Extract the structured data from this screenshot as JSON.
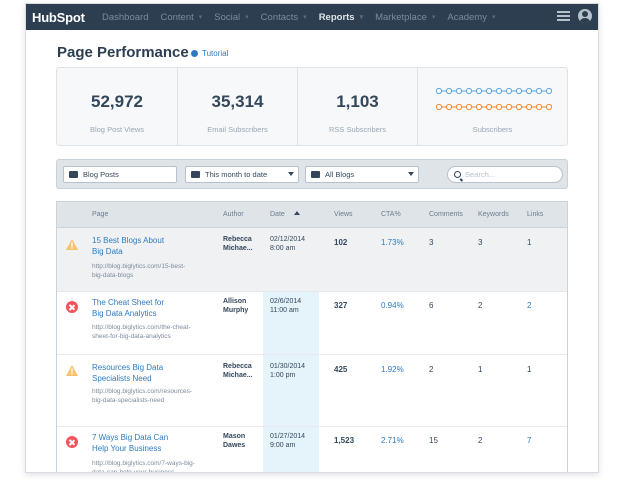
{
  "nav": {
    "logo": "HubSpot",
    "items": [
      {
        "label": "Dashboard",
        "caret": false
      },
      {
        "label": "Content",
        "caret": true
      },
      {
        "label": "Social",
        "caret": true
      },
      {
        "label": "Contacts",
        "caret": true
      },
      {
        "label": "Reports",
        "caret": true,
        "active": true
      },
      {
        "label": "Marketplace",
        "caret": true
      },
      {
        "label": "Academy",
        "caret": true
      }
    ],
    "caret_glyph": "▾"
  },
  "page": {
    "title": "Page Performance",
    "tutorial_label": "Tutorial"
  },
  "stats": [
    {
      "value": "52,972",
      "label": "Blog Post Views"
    },
    {
      "value": "35,314",
      "label": "Email Subscribers"
    },
    {
      "value": "1,103",
      "label": "RSS Subscribers"
    },
    {
      "value": "",
      "label": "Subscribers"
    }
  ],
  "sparkline_colors": {
    "blue": "#5aa5dc",
    "orange": "#f5862b"
  },
  "filters": {
    "content_type": "Blog Posts",
    "date_range": "This month to date",
    "blog": "All Blogs",
    "search_placeholder": "Search..."
  },
  "table": {
    "headers": {
      "page": "Page",
      "author": "Author",
      "date": "Date",
      "views": "Views",
      "cta": "CTA%",
      "comments": "Comments",
      "keywords": "Keywords",
      "links": "Links"
    },
    "rows": [
      {
        "status": "warning",
        "title_l1": "15 Best Blogs About",
        "title_l2": "Big Data",
        "url_l1": "http://blog.biglytics.com/15-best-",
        "url_l2": "big-data-blogs",
        "author_l1": "Rebecca",
        "author_l2": "Michae...",
        "date_l1": "02/12/2014",
        "date_l2": "8:00 am",
        "views": "102",
        "cta": "1.73%",
        "comments": "3",
        "keywords": "3",
        "links": "1"
      },
      {
        "status": "error",
        "title_l1": "The Cheat Sheet for",
        "title_l2": "Big Data Analytics",
        "url_l1": "http://blog.biglytics.com/the-cheat-",
        "url_l2": "sheet-for-big-data-analytics",
        "author_l1": "Allison",
        "author_l2": "Murphy",
        "date_l1": "02/6/2014",
        "date_l2": "11:00 am",
        "views": "327",
        "cta": "0.94%",
        "comments": "6",
        "keywords": "2",
        "links": "2"
      },
      {
        "status": "warning",
        "title_l1": "Resources Big Data",
        "title_l2": "Specialists Need",
        "url_l1": "http://blog.biglytics.com/resources-",
        "url_l2": "big-data-specialists-need",
        "author_l1": "Rebecca",
        "author_l2": "Michae...",
        "date_l1": "01/30/2014",
        "date_l2": "1:00 pm",
        "views": "425",
        "cta": "1.92%",
        "comments": "2",
        "keywords": "1",
        "links": "1"
      },
      {
        "status": "error",
        "title_l1": "7 Ways Big Data Can",
        "title_l2": "Help Your Business",
        "url_l1": "http://blog.biglytics.com/7-ways-big-",
        "url_l2": "data-can-help-your-business",
        "author_l1": "Mason",
        "author_l2": "Dawes",
        "date_l1": "01/27/2014",
        "date_l2": "9:00 am",
        "views": "1,523",
        "cta": "2.71%",
        "comments": "15",
        "keywords": "2",
        "links": "7"
      }
    ]
  }
}
